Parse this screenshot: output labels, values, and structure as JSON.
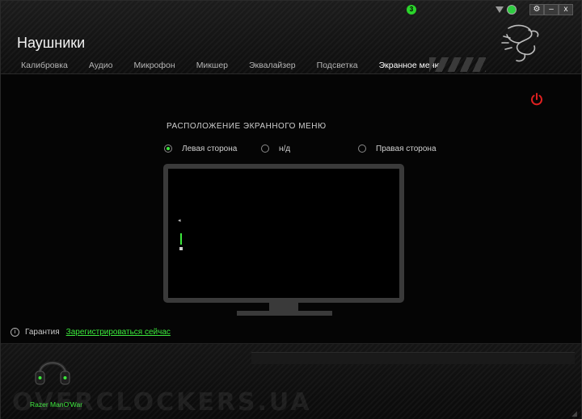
{
  "app": {
    "title": "Наушники",
    "notification_count": "3",
    "window_buttons": {
      "settings": "⚙",
      "minimize": "–",
      "close": "x"
    }
  },
  "tabs": [
    {
      "label": "Калибровка",
      "active": false
    },
    {
      "label": "Аудио",
      "active": false
    },
    {
      "label": "Микрофон",
      "active": false
    },
    {
      "label": "Микшер",
      "active": false
    },
    {
      "label": "Эквалайзер",
      "active": false
    },
    {
      "label": "Подсветка",
      "active": false
    },
    {
      "label": "Экранное меню",
      "active": true
    }
  ],
  "osd": {
    "section_title": "РАСПОЛОЖЕНИЕ ЭКРАННОГО МЕНЮ",
    "options": [
      {
        "label": "Левая сторона",
        "selected": true
      },
      {
        "label": "н/д",
        "selected": false
      },
      {
        "label": "Правая сторона",
        "selected": false
      }
    ],
    "preview_volume_glyph": "◂",
    "preview_level": 0.5
  },
  "warranty": {
    "label": "Гарантия",
    "link": "Зарегистрироваться сейчас",
    "info_glyph": "i"
  },
  "device": {
    "name": "Razer ManO'War"
  },
  "watermark": "OVERCLOCKERS.UA",
  "colors": {
    "accent": "#3ce83c",
    "power": "#e02020",
    "background": "#000000",
    "frame": "#3a3a3a"
  },
  "icons": [
    "notification-badge",
    "dropdown-triangle-icon",
    "sync-icon",
    "gear-icon",
    "minimize-icon",
    "close-icon",
    "razer-logo",
    "power-icon",
    "info-icon",
    "headset-icon"
  ]
}
